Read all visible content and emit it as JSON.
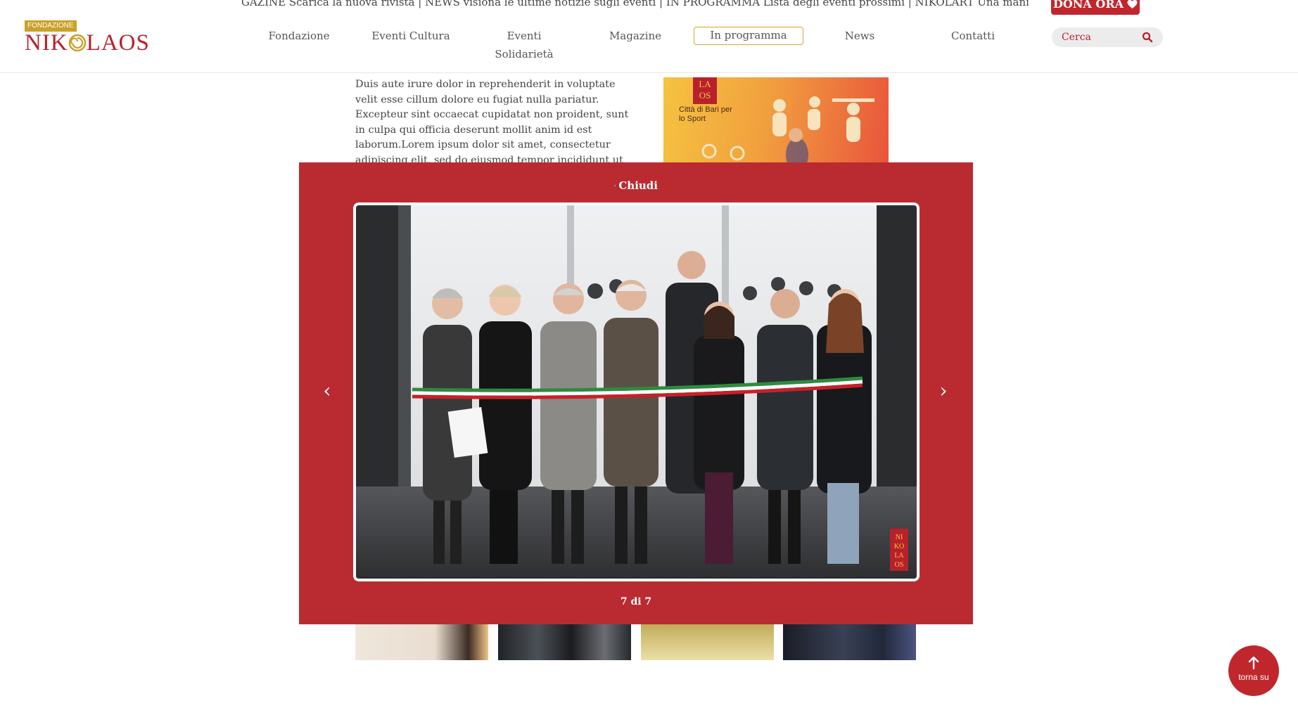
{
  "header": {
    "ticker_text": "AGAZINE Scarica la nuova rivista | NEWS visiona le ultime notizie sugli eventi | IN PROGRAMMA Lista degli eventi prossimi | NIKOLART Una manifestazione coinvolgente | NIKO",
    "donate_label": "DONA ORA",
    "logo_tag": "FONDAZIONE",
    "logo_text_left": "NIK",
    "logo_text_right": "LAOS",
    "nav": [
      {
        "label": "Fondazione"
      },
      {
        "label": "Eventi Cultura"
      },
      {
        "label": "Eventi Solidarietà"
      },
      {
        "label": "Magazine"
      },
      {
        "label": "In programma",
        "active": true
      },
      {
        "label": "News"
      },
      {
        "label": "Contatti"
      }
    ],
    "search_placeholder": "Cerca"
  },
  "article": {
    "text": "Duis aute irure dolor in reprehenderit in voluptate velit esse cillum dolore eu fugiat nulla pariatur. Excepteur sint occaecat cupidatat non proident, sunt in culpa qui officia deserunt mollit anim id est laborum.Lorem ipsum dolor sit amet, consectetur adipiscing elit, sed do eiusmod tempor incididunt ut labore et dolore magna aliqua. Ut enim ad"
  },
  "banner": {
    "badge_text": "LA OS",
    "caption": "Città di Bari per lo Sport"
  },
  "lightbox": {
    "close_label": "Chiudi",
    "prev_label": "‹",
    "next_label": "›",
    "counter": "7 di 7",
    "watermark": "NIKOLAOS"
  },
  "back_to_top_label": "torna su",
  "colors": {
    "brand_red": "#ba2b31",
    "gold": "#c9a227",
    "nav_text": "#555555"
  }
}
